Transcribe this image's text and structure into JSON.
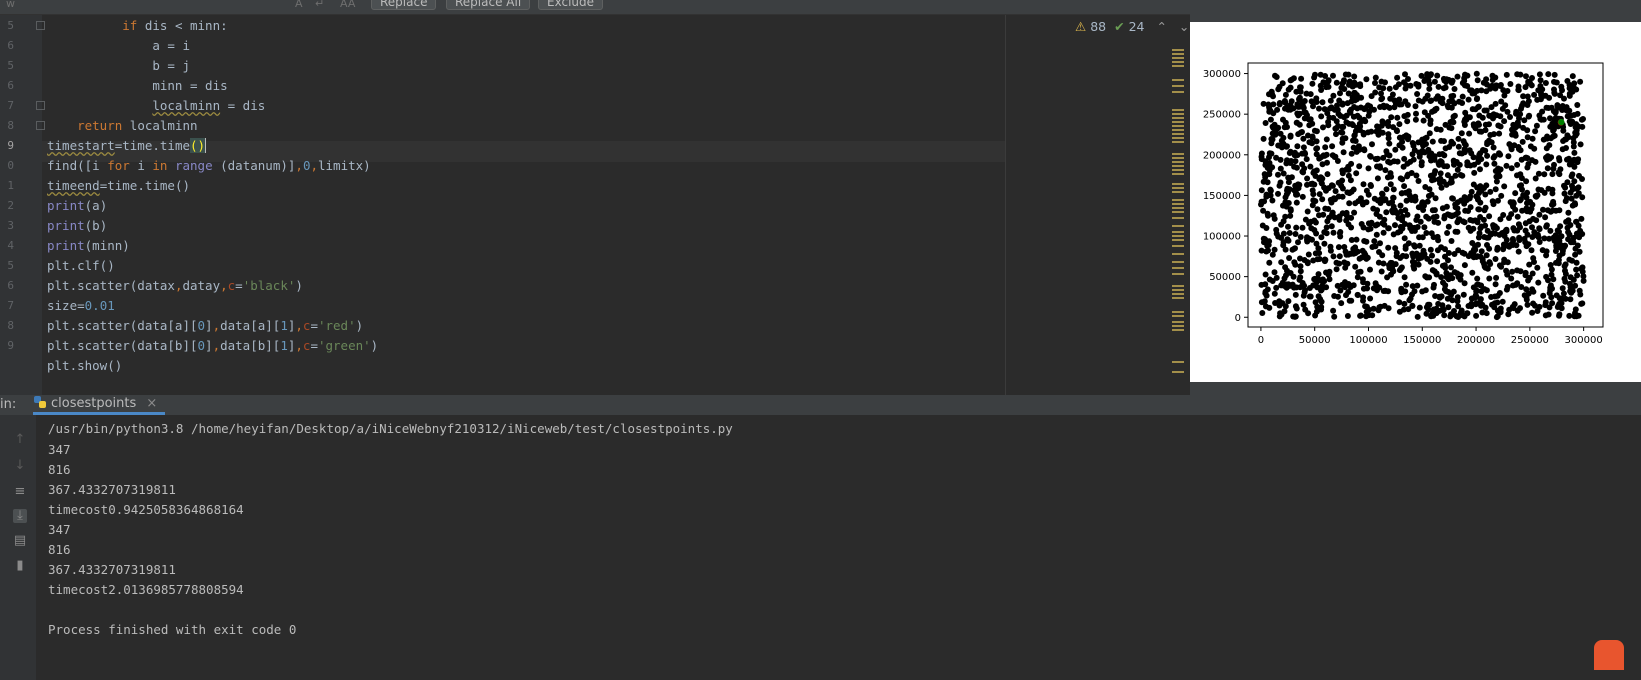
{
  "find_bar": {
    "buttons": [
      "Replace",
      "Replace All",
      "Exclude"
    ]
  },
  "editor": {
    "inspections": {
      "warnings": "88",
      "weak_warnings": "24"
    },
    "gutter_numbers": [
      "5",
      "6",
      "5",
      "6",
      "7",
      "8",
      "9",
      "0",
      "1",
      "2",
      "3",
      "4",
      "5",
      "6",
      "7",
      "8",
      "9"
    ],
    "current_line_number": "9"
  },
  "plot": {
    "chart_data": {
      "type": "scatter",
      "title": "",
      "xlabel": "",
      "ylabel": "",
      "xlim": [
        -12000,
        318000
      ],
      "ylim": [
        -12000,
        313000
      ],
      "x_ticks": [
        "0",
        "50000",
        "100000",
        "150000",
        "200000",
        "250000",
        "300000"
      ],
      "y_ticks": [
        "0",
        "50000",
        "100000",
        "150000",
        "200000",
        "250000",
        "300000"
      ],
      "series": [
        {
          "name": "",
          "color": "#000000",
          "count": 2000,
          "x_range": [
            0,
            300000
          ],
          "y_range": [
            0,
            300000
          ]
        },
        {
          "name": "",
          "color": "#ff0000",
          "points": [
            [
              279000,
              240000
            ]
          ]
        },
        {
          "name": "",
          "color": "#008000",
          "points": [
            [
              279200,
              240200
            ]
          ]
        }
      ],
      "grid": false,
      "legend": "none"
    }
  },
  "run_panel": {
    "label": "in:",
    "tab": "closestpoints",
    "console_lines": [
      "/usr/bin/python3.8 /home/heyifan/Desktop/a/iNiceWebnyf210312/iNiceweb/test/closestpoints.py",
      "347",
      "816",
      "367.4332707319811",
      "timecost0.9425058364868164",
      "347",
      "816",
      "367.4332707319811",
      "timecost2.0136985778808594",
      "",
      "Process finished with exit code 0"
    ]
  },
  "icons": {
    "run_panel": [
      "up-arrow-icon",
      "down-arrow-icon",
      "soft-wrap-icon",
      "scroll-to-end-icon",
      "print-icon",
      "trash-icon",
      "close-icon",
      "python-icon"
    ],
    "editor": [
      "warning-icon",
      "check-icon",
      "chevron-up-icon",
      "chevron-down-icon"
    ]
  },
  "colors": {
    "keyword": "#cc7832",
    "builtin": "#8888c6",
    "number": "#6897bb",
    "string": "#6a8759",
    "text": "#a9b7c6",
    "background": "#2b2b2b"
  }
}
